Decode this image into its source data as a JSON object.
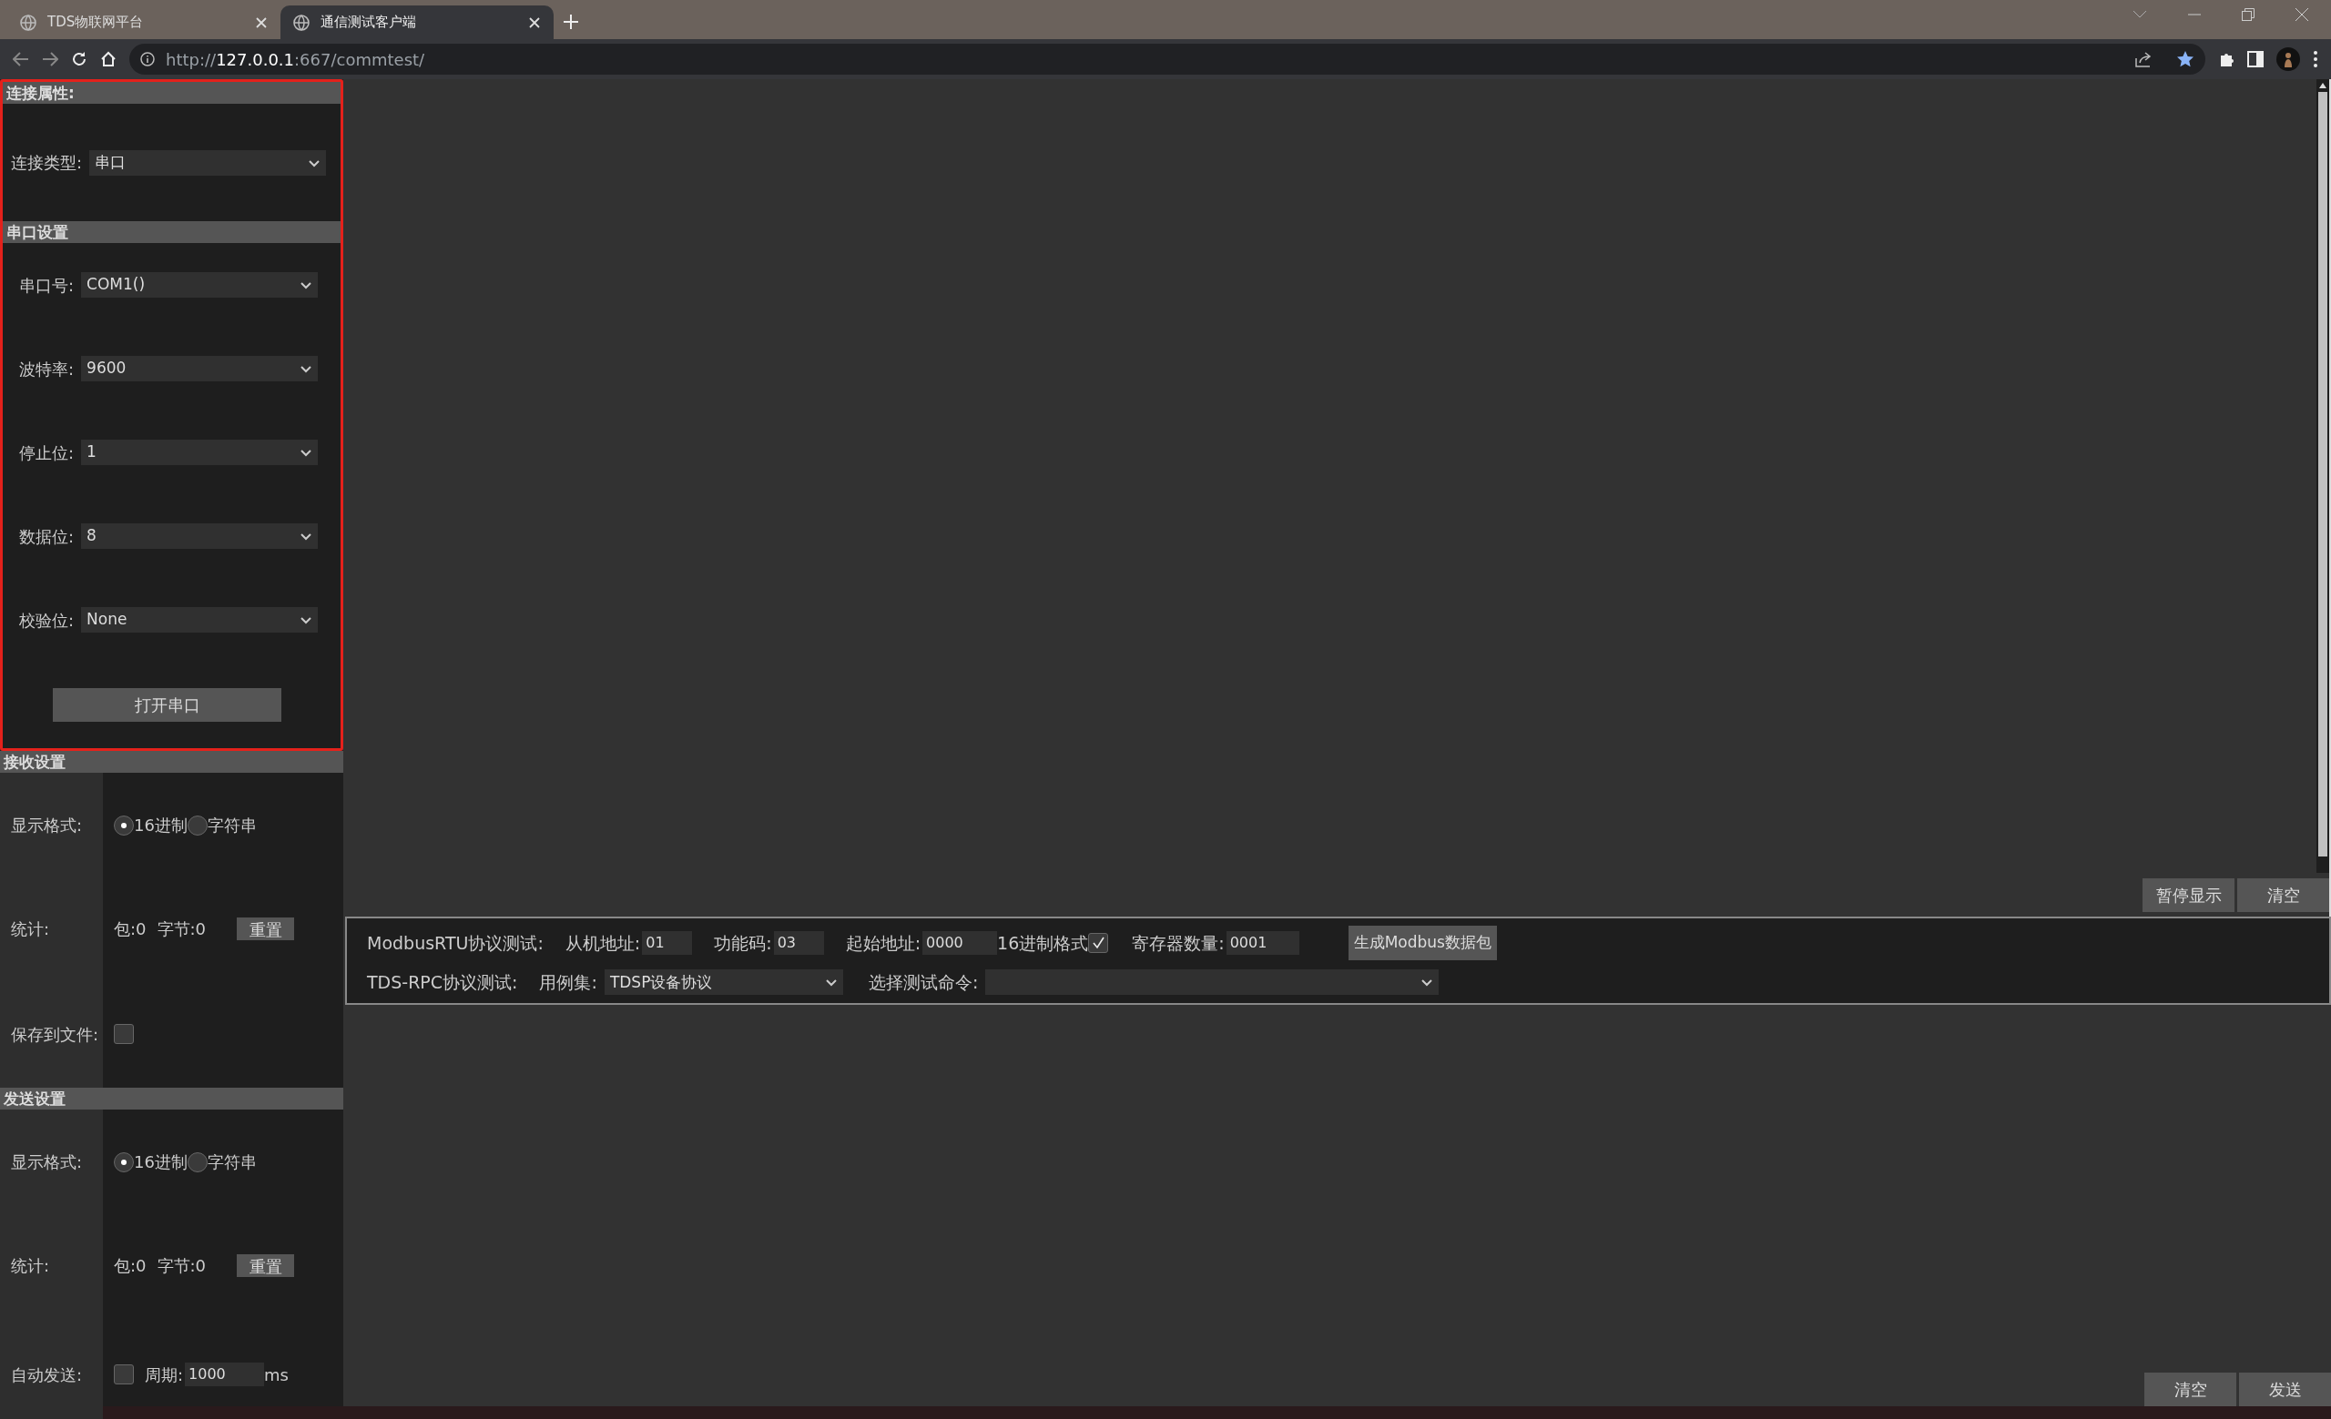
{
  "browser": {
    "tabs": [
      {
        "title": "TDS物联网平台",
        "selected": false
      },
      {
        "title": "通信测试客户端",
        "selected": true
      }
    ],
    "url": {
      "scheme": "http://",
      "host": "127.0.0.1",
      "path": ":667/commtest/"
    }
  },
  "connection": {
    "title": "连接属性:",
    "fields": [
      {
        "label": "连接类型:",
        "value": "串口"
      }
    ]
  },
  "serial": {
    "title": "串口设置",
    "fields": [
      {
        "label": "串口号:",
        "value": "COM1()"
      },
      {
        "label": "波特率:",
        "value": "9600"
      },
      {
        "label": "停止位:",
        "value": "1"
      },
      {
        "label": "数据位:",
        "value": "8"
      },
      {
        "label": "校验位:",
        "value": "None"
      }
    ],
    "button": "打开串口"
  },
  "receive": {
    "title": "接收设置",
    "format": {
      "label": "显示格式:",
      "options": [
        {
          "label": "16进制",
          "selected": true
        },
        {
          "label": "字符串",
          "selected": false
        }
      ]
    },
    "stats": {
      "label": "统计:",
      "packets": "包:0",
      "bytes": "字节:0",
      "button": "重置"
    },
    "save": {
      "label": "保存到文件:",
      "checked": false
    }
  },
  "send": {
    "title": "发送设置",
    "format": {
      "label": "显示格式:",
      "options": [
        {
          "label": "16进制",
          "selected": true
        },
        {
          "label": "字符串",
          "selected": false
        }
      ]
    },
    "stats": {
      "label": "统计:",
      "packets": "包:0",
      "bytes": "字节:0",
      "button": "重置"
    },
    "auto": {
      "label": "自动发送:",
      "checked": false,
      "period_label": "周期:",
      "period": "1000",
      "unit": "ms"
    }
  },
  "output_buttons": [
    "暂停显示",
    "清空"
  ],
  "modbus": {
    "title": "ModbusRTU协议测试:",
    "fields": [
      {
        "label": "从机地址:",
        "value": "01"
      },
      {
        "label": "功能码:",
        "value": "03"
      },
      {
        "label": "起始地址:",
        "value": "0000"
      }
    ],
    "hex": {
      "label": "16进制格式",
      "checked": true
    },
    "count": {
      "label": "寄存器数量:",
      "value": "0001"
    },
    "button": "生成Modbus数据包"
  },
  "rpc": {
    "title": "TDS-RPC协议测试:",
    "case_label": "用例集:",
    "case_value": "TDSP设备协议",
    "command_label": "选择测试命令:"
  },
  "send_buttons": [
    "清空",
    "发送"
  ]
}
